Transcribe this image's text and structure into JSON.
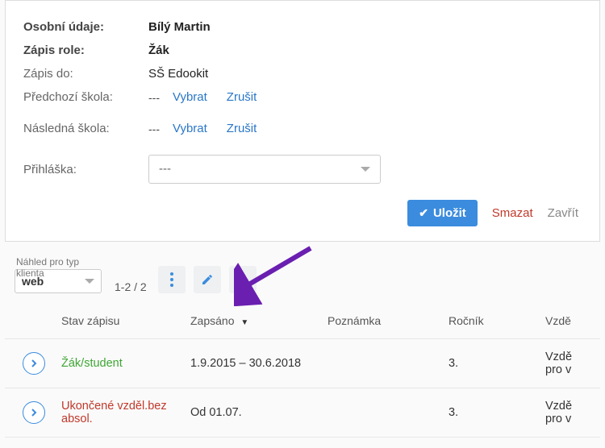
{
  "form": {
    "fields": {
      "personal_label": "Osobní údaje:",
      "personal_value": "Bílý Martin",
      "role_label": "Zápis role:",
      "role_value": "Žák",
      "enroll_to_label": "Zápis do:",
      "enroll_to_value": "SŠ Edookit",
      "prev_school_label": "Předchozí škola:",
      "prev_school_value": "---",
      "next_school_label": "Následná škola:",
      "next_school_value": "---",
      "application_label": "Přihláška:",
      "application_value": "---",
      "select_action": "Vybrat",
      "cancel_action": "Zrušit"
    },
    "actions": {
      "save": "Uložit",
      "delete": "Smazat",
      "close": "Zavřít"
    }
  },
  "list": {
    "client_type_label": "Náhled pro typ klienta",
    "client_type_value": "web",
    "pager": "1-2 / 2",
    "columns": {
      "status": "Stav zápisu",
      "enrolled": "Zapsáno",
      "note": "Poznámka",
      "year": "Ročník",
      "edu": "Vzdě"
    },
    "rows": [
      {
        "status": "Žák/student",
        "status_kind": "active",
        "enrolled": "1.9.2015 – 30.6.2018",
        "note": "",
        "year": "3.",
        "edu": "Vzdě\npro v"
      },
      {
        "status": "Ukončené vzděl.bez absol.",
        "status_kind": "terminated",
        "enrolled": "Od 01.07.",
        "note": "",
        "year": "3.",
        "edu": "Vzdě\npro v"
      }
    ]
  }
}
